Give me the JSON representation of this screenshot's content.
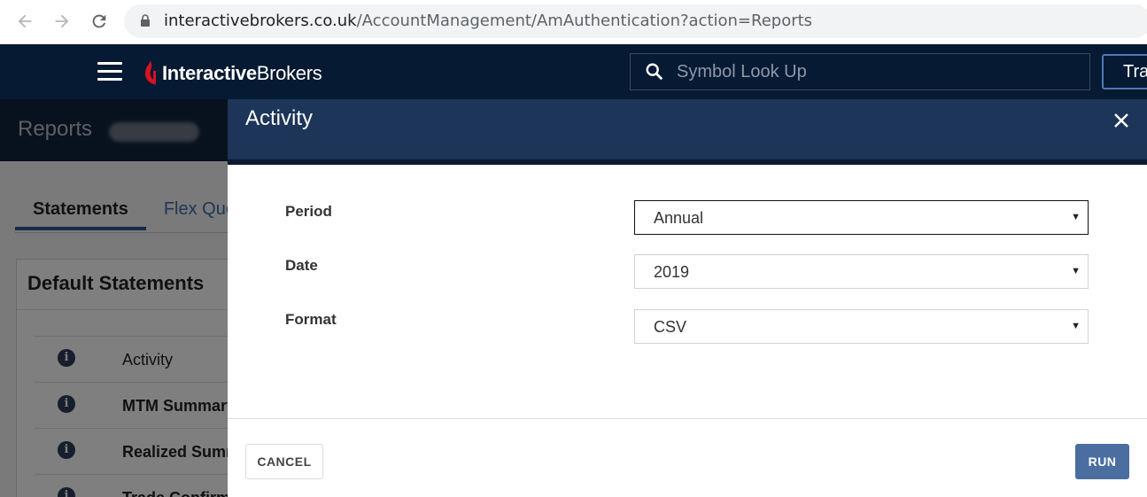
{
  "browser": {
    "url_host": "interactivebrokers.co.uk",
    "url_path": "/AccountManagement/AmAuthentication?action=Reports"
  },
  "header": {
    "logo_bold": "Interactive",
    "logo_regular": "Brokers",
    "search_placeholder": "Symbol Look Up",
    "trade_label": "Trade"
  },
  "page": {
    "title": "Reports",
    "tabs": [
      {
        "label": "Statements",
        "active": true
      },
      {
        "label": "Flex Queries",
        "active": false
      }
    ],
    "card_title": "Default Statements",
    "statements": [
      {
        "label": "Activity"
      },
      {
        "label": "MTM Summary"
      },
      {
        "label": "Realized Summary"
      },
      {
        "label": "Trade Confirmation"
      }
    ]
  },
  "modal": {
    "title": "Activity",
    "fields": [
      {
        "label": "Period",
        "value": "Annual"
      },
      {
        "label": "Date",
        "value": "2019"
      },
      {
        "label": "Format",
        "value": "CSV"
      }
    ],
    "cancel_label": "CANCEL",
    "run_label": "RUN"
  },
  "colors": {
    "header_bg": "#071a33",
    "modal_header_bg": "#1c3558",
    "run_button": "#4a6e9f",
    "logo_red": "#d81222"
  }
}
